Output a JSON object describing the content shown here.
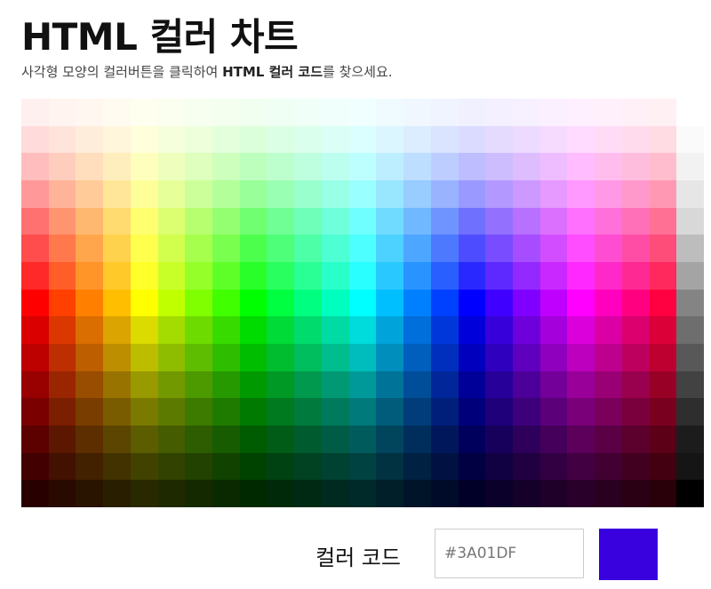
{
  "header": {
    "title": "HTML 컬러 차트",
    "subtitle_before": "사각형 모양의 컬러버튼을 클릭하여 ",
    "subtitle_bold": "HTML 컬러 코드",
    "subtitle_after": "를 찾으세요."
  },
  "palette": {
    "hues": [
      0,
      15,
      30,
      45,
      60,
      75,
      90,
      105,
      120,
      135,
      150,
      165,
      180,
      195,
      210,
      225,
      240,
      255,
      270,
      285,
      300,
      315,
      330,
      345
    ],
    "lightness_rows": [
      97,
      93,
      87,
      80,
      72,
      65,
      58,
      50,
      43,
      37,
      30,
      24,
      18,
      13,
      8
    ],
    "grays": [
      "",
      "#FAFAFA",
      "#F2F2F2",
      "#E6E6E6",
      "#D8D8D8",
      "#BDBDBD",
      "#A4A4A4",
      "#848484",
      "#6E6E6E",
      "#585858",
      "#424242",
      "#2E2E2E",
      "#1C1C1C",
      "#151515",
      "#000000"
    ]
  },
  "color_code": {
    "label": "컬러 코드",
    "value": "#3A01DF",
    "preview_color": "#3A01DF"
  }
}
